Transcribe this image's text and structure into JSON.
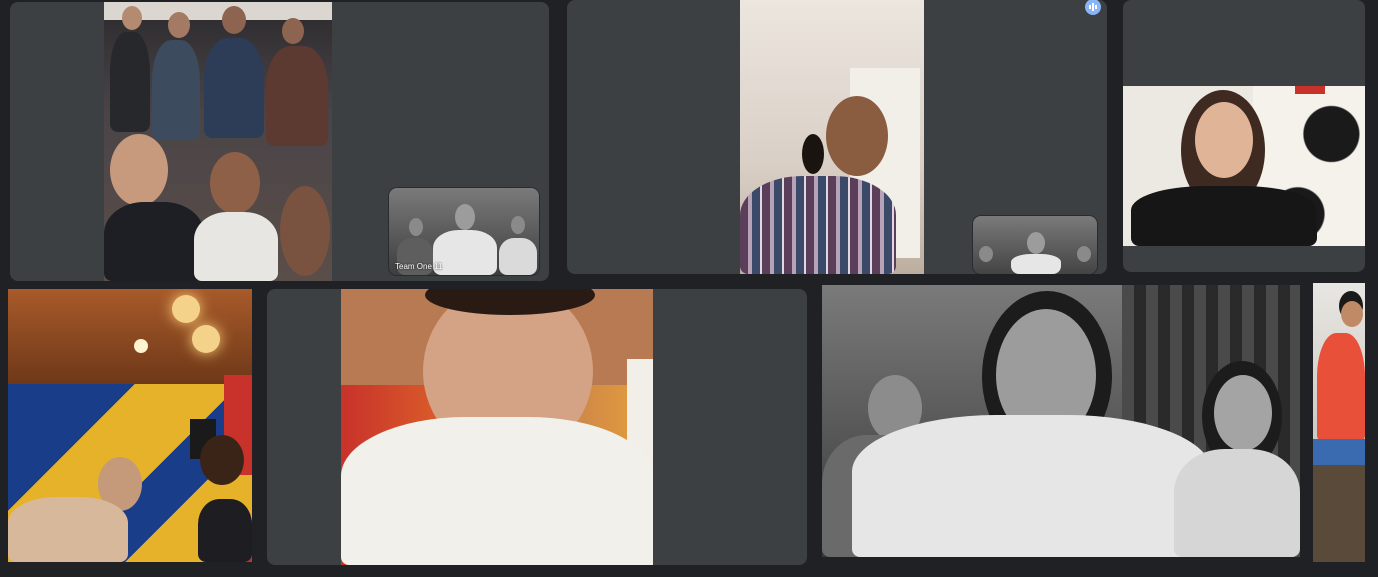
{
  "meeting": {
    "participants": [
      {
        "id": "p1",
        "description_tile": "group-studio-1"
      },
      {
        "id": "p2",
        "description_tile": "guitarist"
      },
      {
        "id": "p3",
        "description_tile": "singer-girl"
      },
      {
        "id": "p4",
        "description_tile": "group-studio-2"
      },
      {
        "id": "p5",
        "description_tile": "man-white-shirt"
      },
      {
        "id": "p6",
        "description_tile": "bw-trio"
      },
      {
        "id": "p7",
        "description_tile": "keyboardist"
      }
    ],
    "self_view_label": "Team One 11"
  },
  "colors": {
    "background": "#202124",
    "tile": "#3c4043",
    "speaking_indicator": "#8ab4f8"
  }
}
